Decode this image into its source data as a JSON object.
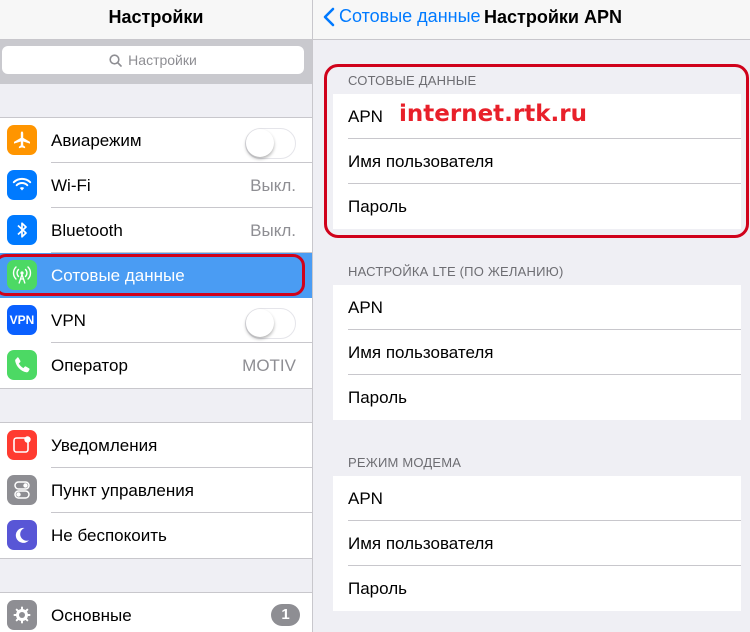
{
  "left": {
    "title": "Настройки",
    "search_placeholder": "Настройки",
    "group1": [
      {
        "label": "Авиарежим",
        "icon": "airplane-icon",
        "color": "#ff9500",
        "control": "toggle",
        "on": false
      },
      {
        "label": "Wi-Fi",
        "icon": "wifi-icon",
        "color": "#007aff",
        "value": "Выкл."
      },
      {
        "label": "Bluetooth",
        "icon": "bluetooth-icon",
        "color": "#007aff",
        "value": "Выкл."
      },
      {
        "label": "Сотовые данные",
        "icon": "cellular-antenna-icon",
        "color": "#4cd964",
        "selected": true
      },
      {
        "label": "VPN",
        "icon": "vpn-icon",
        "icon_text": "VPN",
        "color": "#0a60ff",
        "control": "toggle",
        "on": false
      },
      {
        "label": "Оператор",
        "icon": "phone-icon",
        "color": "#4cd964",
        "value": "MOTIV"
      }
    ],
    "group2": [
      {
        "label": "Уведомления",
        "icon": "notifications-icon",
        "color": "#ff3b30"
      },
      {
        "label": "Пункт управления",
        "icon": "control-center-icon",
        "color": "#8e8e93"
      },
      {
        "label": "Не беспокоить",
        "icon": "moon-icon",
        "color": "#5856d6"
      }
    ],
    "group3": [
      {
        "label": "Основные",
        "icon": "gear-icon",
        "color": "#8e8e93",
        "badge": "1"
      }
    ]
  },
  "right": {
    "back_label": "Сотовые данные",
    "title": "Настройки APN",
    "sections": [
      {
        "header": "СОТОВЫЕ ДАННЫЕ",
        "rows": [
          {
            "label": "APN",
            "value": ""
          },
          {
            "label": "Имя пользователя",
            "value": ""
          },
          {
            "label": "Пароль",
            "value": ""
          }
        ]
      },
      {
        "header": "НАСТРОЙКА LTE (ПО ЖЕЛАНИЮ)",
        "rows": [
          {
            "label": "APN",
            "value": ""
          },
          {
            "label": "Имя пользователя",
            "value": ""
          },
          {
            "label": "Пароль",
            "value": ""
          }
        ]
      },
      {
        "header": "РЕЖИМ МОДЕМА",
        "rows": [
          {
            "label": "APN",
            "value": ""
          },
          {
            "label": "Имя пользователя",
            "value": ""
          },
          {
            "label": "Пароль",
            "value": ""
          }
        ]
      }
    ],
    "apn_annotation": "internet.rtk.ru"
  },
  "colors": {
    "accent": "#007aff",
    "highlight_outline": "#d0021b",
    "selected_row": "#4a9cf3",
    "annotation": "#e8202a"
  }
}
